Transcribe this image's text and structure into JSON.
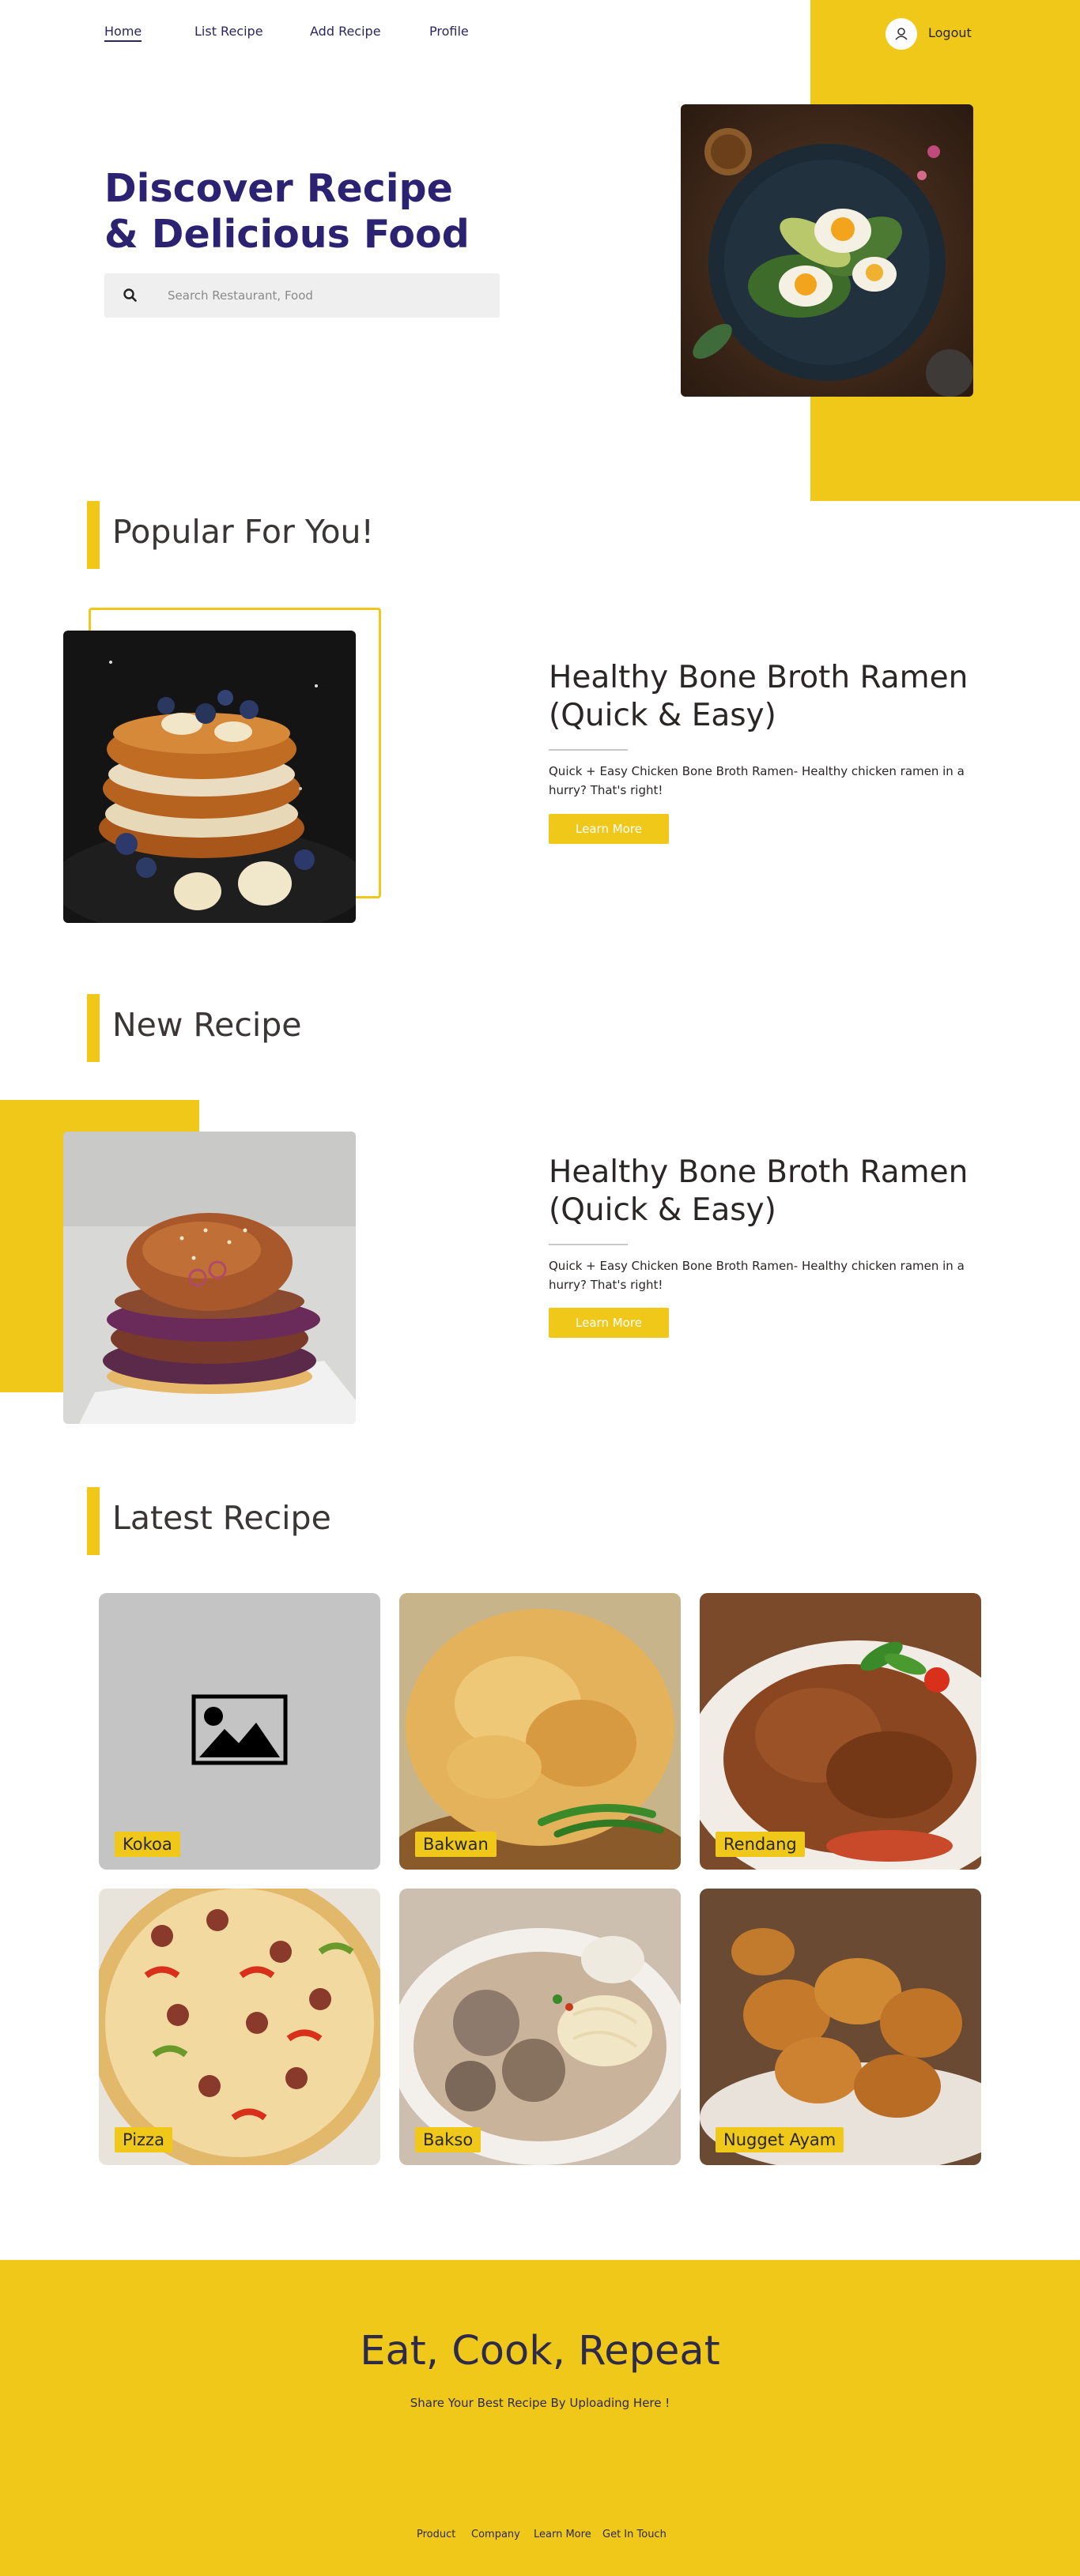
{
  "nav": {
    "links": [
      "Home",
      "List Recipe",
      "Add Recipe",
      "Profile"
    ],
    "logout": "Logout"
  },
  "hero": {
    "title_line1": "Discover Recipe",
    "title_line2": "& Delicious Food",
    "search_placeholder": "Search Restaurant, Food"
  },
  "popular": {
    "heading": "Popular For You!",
    "title": "Healthy Bone Broth Ramen (Quick & Easy)",
    "description": "Quick + Easy Chicken Bone Broth Ramen- Healthy chicken ramen in a hurry? That's right!",
    "button": "Learn More"
  },
  "new_recipe": {
    "heading": "New Recipe",
    "title": "Healthy Bone Broth Ramen (Quick & Easy)",
    "description": "Quick + Easy Chicken Bone Broth Ramen- Healthy chicken ramen in a hurry? That's right!",
    "button": "Learn More"
  },
  "latest": {
    "heading": "Latest Recipe",
    "items": [
      "Kokoa",
      "Bakwan",
      "Rendang",
      "Pizza",
      "Bakso",
      "Nugget Ayam"
    ]
  },
  "footer": {
    "title": "Eat, Cook, Repeat",
    "subtitle": "Share Your Best Recipe By Uploading Here !",
    "links": [
      "Product",
      "Company",
      "Learn More",
      "Get In Touch"
    ]
  },
  "colors": {
    "accent": "#efc81a",
    "brand": "#2b2372"
  }
}
